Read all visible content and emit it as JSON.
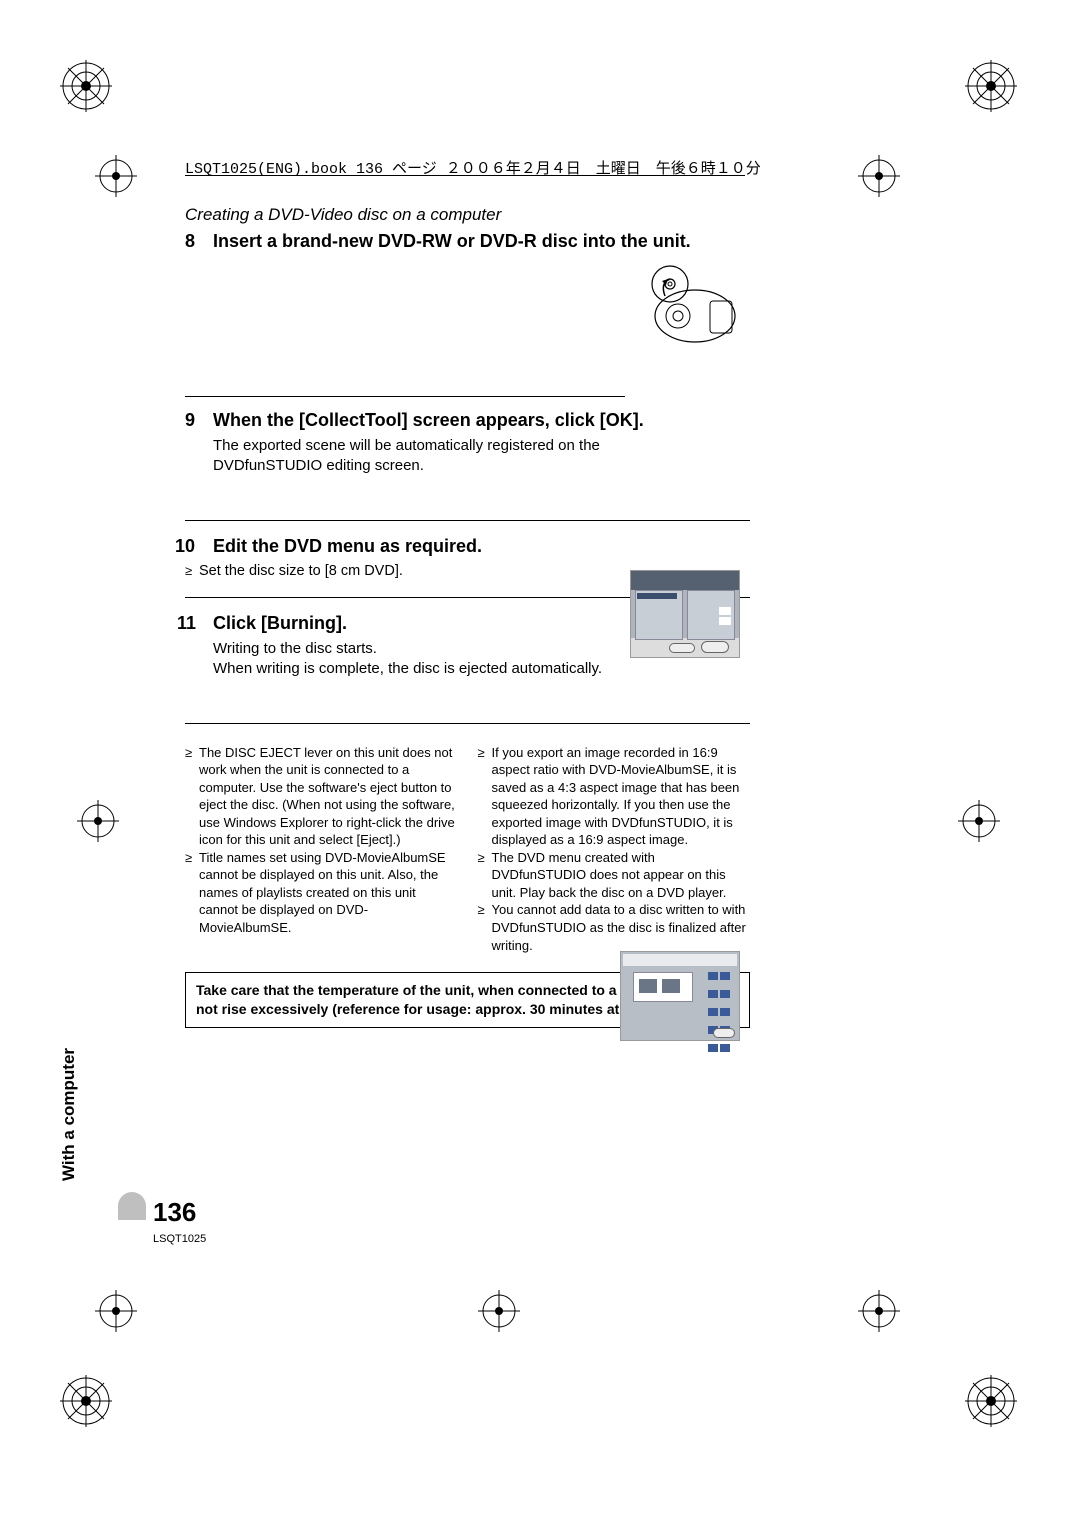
{
  "header_text": "LSQT1025(ENG).book  136 ページ  ２００６年２月４日　土曜日　午後６時１０分",
  "breadcrumb": "Creating a DVD-Video disc on a computer",
  "steps": {
    "s8": {
      "num": "8",
      "title": "Insert a brand-new DVD-RW or DVD-R disc into the unit."
    },
    "s9": {
      "num": "9",
      "title": "When the [CollectTool] screen appears, click [OK].",
      "body": "The exported scene will be automatically registered on the DVDfunSTUDIO editing screen."
    },
    "s10": {
      "num": "10",
      "title": "Edit the DVD menu as required.",
      "bullet": "Set the disc size to [8 cm DVD]."
    },
    "s11": {
      "num": "11",
      "title": "Click [Burning].",
      "body1": "Writing to the disc starts.",
      "body2": "When writing is complete, the disc is ejected automatically."
    }
  },
  "notes_left": {
    "n1": "The DISC EJECT lever on this unit does not work when the unit is connected to a computer. Use the software's eject button to eject the disc. (When not using the software, use Windows Explorer to right-click the drive icon for this unit and select [Eject].)",
    "n2": "Title names set using DVD-MovieAlbumSE cannot be displayed on this unit. Also, the names of playlists created on this unit cannot be displayed on DVD-MovieAlbumSE."
  },
  "notes_right": {
    "n1": "If you export an image recorded in 16:9 aspect ratio with DVD-MovieAlbumSE, it is saved as a 4:3 aspect image that has been squeezed horizontally. If you then use the exported image with DVDfunSTUDIO, it is displayed as a 16:9 aspect image.",
    "n2": "The DVD menu created with DVDfunSTUDIO does not appear on this unit. Play back the disc on a DVD player.",
    "n3": "You cannot add data to a disc written to with DVDfunSTUDIO as the disc is finalized after writing."
  },
  "warning": "Take care that the temperature of the unit, when connected to a computer, does not rise excessively (reference for usage: approx. 30 minutes at about 30 °C).",
  "side_tab": "With a computer",
  "page_number": "136",
  "doc_id": "LSQT1025"
}
